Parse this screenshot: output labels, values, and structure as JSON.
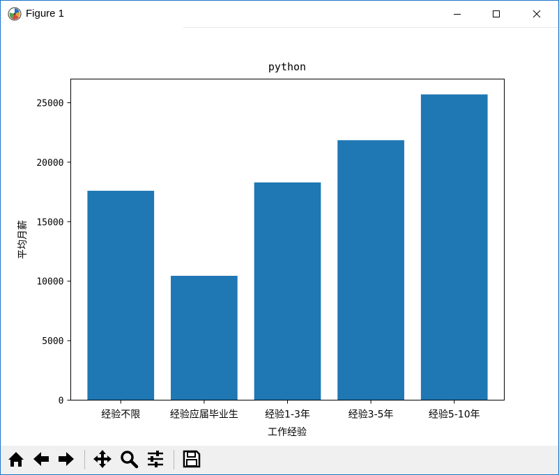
{
  "window": {
    "title": "Figure 1",
    "icons": {
      "app": "matplotlib-icon",
      "minimize": "minimize-icon",
      "maximize": "maximize-icon",
      "close": "close-icon"
    }
  },
  "toolbar": {
    "buttons": [
      {
        "name": "home-icon",
        "label": "Home"
      },
      {
        "name": "back-arrow-icon",
        "label": "Back"
      },
      {
        "name": "forward-arrow-icon",
        "label": "Forward"
      },
      {
        "name": "pan-move-icon",
        "label": "Pan"
      },
      {
        "name": "zoom-magnifier-icon",
        "label": "Zoom"
      },
      {
        "name": "configure-subplots-icon",
        "label": "Subplots"
      },
      {
        "name": "save-floppy-icon",
        "label": "Save"
      }
    ]
  },
  "chart_data": {
    "type": "bar",
    "title": "python",
    "xlabel": "工作经验",
    "ylabel": "平均月薪",
    "categories": [
      "经验不限",
      "经验应届毕业生",
      "经验1-3年",
      "经验3-5年",
      "经验5-10年"
    ],
    "values": [
      17600,
      10450,
      18300,
      21850,
      25700
    ],
    "ylim": [
      0,
      26990
    ],
    "yticks": [
      0,
      5000,
      10000,
      15000,
      20000,
      25000
    ],
    "bar_color": "#1f77b4",
    "grid": false,
    "legend": "none"
  }
}
